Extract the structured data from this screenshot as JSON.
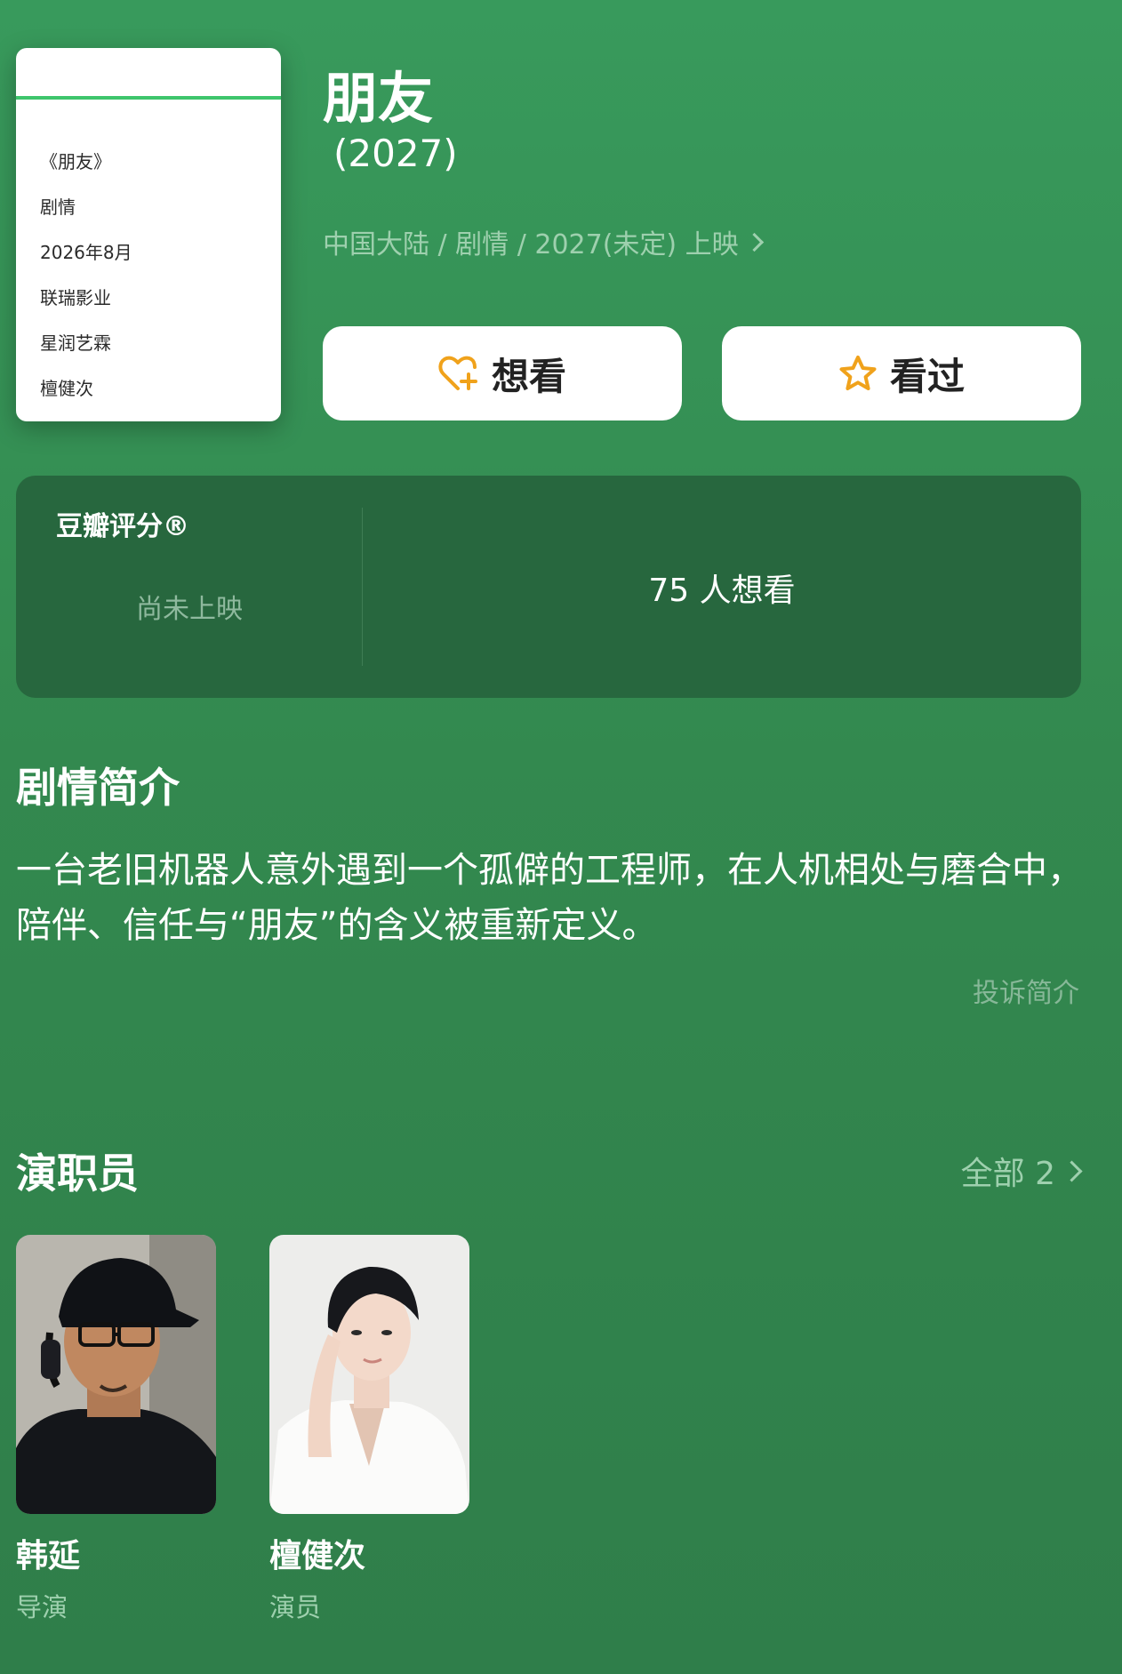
{
  "poster": {
    "lines": [
      "《朋友》",
      "剧情",
      "2026年8月",
      "联瑞影业",
      "星润艺霖",
      "檀健次"
    ]
  },
  "movie": {
    "title": "朋友",
    "year": "(2027)",
    "meta": "中国大陆 / 剧情 / 2027(未定) 上映"
  },
  "actions": {
    "want_label": "想看",
    "seen_label": "看过"
  },
  "rating": {
    "brand": "豆瓣评分®",
    "status": "尚未上映",
    "want_count": "75 人想看"
  },
  "synopsis": {
    "heading": "剧情简介",
    "text": "一台老旧机器人意外遇到一个孤僻的工程师，在人机相处与磨合中，陪伴、信任与“朋友”的含义被重新定义。",
    "report_label": "投诉简介"
  },
  "cast": {
    "heading": "演职员",
    "all_label": "全部 2",
    "members": [
      {
        "name": "韩延",
        "role": "导演"
      },
      {
        "name": "檀健次",
        "role": "演员"
      }
    ]
  },
  "colors": {
    "background": "#389a5c",
    "card": "#27673e",
    "accent_orange": "#f0a21b",
    "muted_text": "#9ed0ae"
  },
  "icons": {
    "want": "heart-plus-icon",
    "seen": "star-outline-icon",
    "more": "chevron-right-icon"
  }
}
